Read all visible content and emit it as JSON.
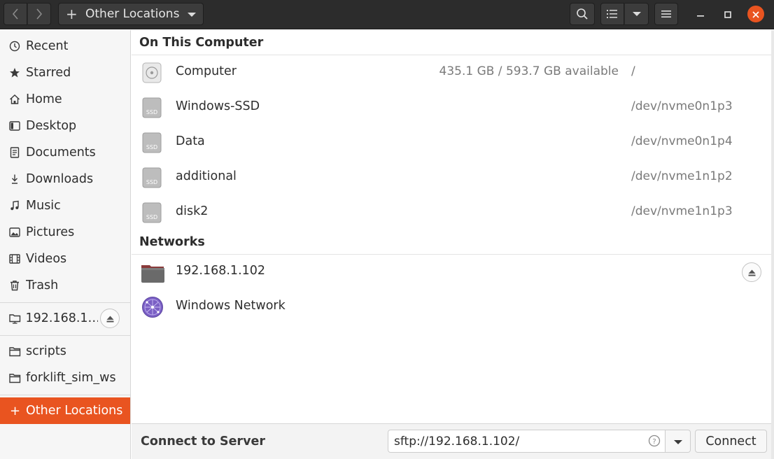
{
  "header": {
    "location_label": "Other Locations",
    "location_icon": "+",
    "icons": {
      "back": "chevron-left-icon",
      "forward": "chevron-right-icon",
      "search": "search-icon",
      "view": "list-view-icon",
      "view_menu": "chevron-down-icon",
      "menu": "hamburger-icon",
      "minimize": "minimize-icon",
      "maximize": "maximize-icon",
      "close": "close-icon"
    }
  },
  "sidebar": {
    "places": [
      {
        "label": "Recent",
        "icon": "clock-icon"
      },
      {
        "label": "Starred",
        "icon": "star-icon"
      },
      {
        "label": "Home",
        "icon": "home-icon"
      },
      {
        "label": "Desktop",
        "icon": "desktop-icon"
      },
      {
        "label": "Documents",
        "icon": "documents-icon"
      },
      {
        "label": "Downloads",
        "icon": "download-icon"
      },
      {
        "label": "Music",
        "icon": "music-icon"
      },
      {
        "label": "Pictures",
        "icon": "pictures-icon"
      },
      {
        "label": "Videos",
        "icon": "videos-icon"
      },
      {
        "label": "Trash",
        "icon": "trash-icon"
      }
    ],
    "mounts": [
      {
        "label": "192.168.1…",
        "icon": "network-folder-icon",
        "eject_icon": "eject-icon"
      }
    ],
    "bookmarks": [
      {
        "label": "scripts",
        "icon": "folder-icon"
      },
      {
        "label": "forklift_sim_ws",
        "icon": "folder-icon"
      }
    ],
    "other": {
      "label": "Other Locations",
      "icon": "+"
    }
  },
  "main": {
    "on_this_computer_title": "On This Computer",
    "devices": [
      {
        "name": "Computer",
        "space": "435.1 GB / 593.7 GB available",
        "path": "/",
        "icon": "harddisk-icon"
      },
      {
        "name": "Windows-SSD",
        "space": "",
        "path": "/dev/nvme0n1p3",
        "icon": "ssd-icon"
      },
      {
        "name": "Data",
        "space": "",
        "path": "/dev/nvme0n1p4",
        "icon": "ssd-icon"
      },
      {
        "name": "additional",
        "space": "",
        "path": "/dev/nvme1n1p2",
        "icon": "ssd-icon"
      },
      {
        "name": "disk2",
        "space": "",
        "path": "/dev/nvme1n1p3",
        "icon": "ssd-icon"
      }
    ],
    "ssd_label": "SSD",
    "networks_title": "Networks",
    "networks": [
      {
        "name": "192.168.1.102",
        "icon": "network-folder-icon",
        "eject_icon": "eject-icon"
      },
      {
        "name": "Windows Network",
        "icon": "network-globe-icon"
      }
    ]
  },
  "connect": {
    "label": "Connect to Server",
    "server_value": "sftp://192.168.1.102/",
    "help_icon": "help-icon",
    "dropdown_icon": "chevron-down-icon",
    "button_label": "Connect"
  },
  "colors": {
    "accent": "#e95420",
    "header_bg": "#2c2c2c",
    "sidebar_bg": "#f6f6f6",
    "secondary_text": "#7a7a7a"
  }
}
